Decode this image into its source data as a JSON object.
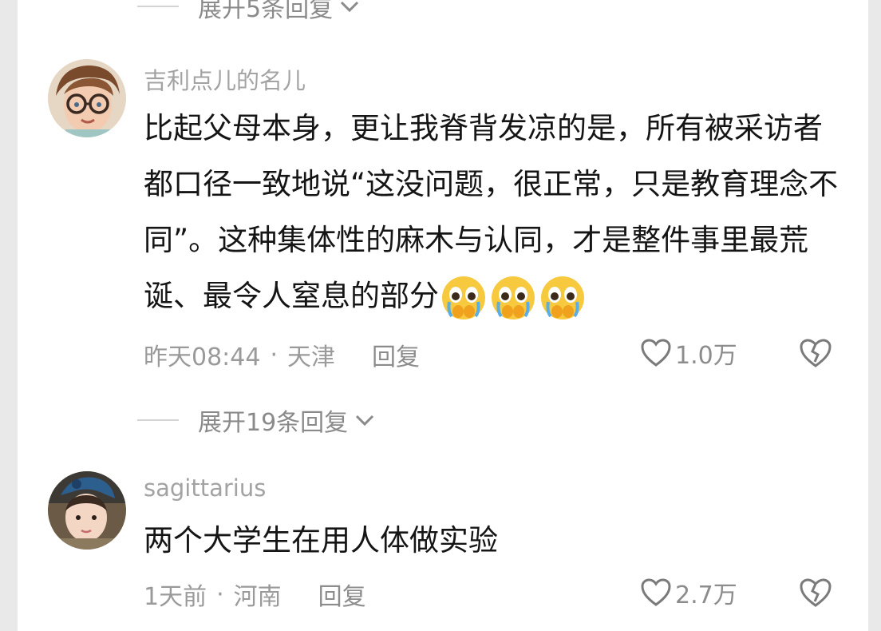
{
  "top_expand": {
    "label": "展开5条回复"
  },
  "comments": [
    {
      "username": "吉利点儿的名儿",
      "text": "比起父母本身，更让我脊背发凉的是，所有被采访者都口径一致地说“这没问题，很正常，只是教育理念不同”。这种集体性的麻木与认同，才是整件事里最荒诞、最令人窒息的部分",
      "emojis": [
        "crying-emoji",
        "crying-emoji",
        "crying-emoji"
      ],
      "time": "昨天08:44",
      "dot": "·",
      "location": "天津",
      "reply": "回复",
      "likes": "1.0万",
      "expand": "展开19条回复"
    },
    {
      "username": "sagittarius",
      "text": "两个大学生在用人体做实验",
      "time": "1天前",
      "dot": "·",
      "location": "河南",
      "reply": "回复",
      "likes": "2.7万"
    }
  ]
}
